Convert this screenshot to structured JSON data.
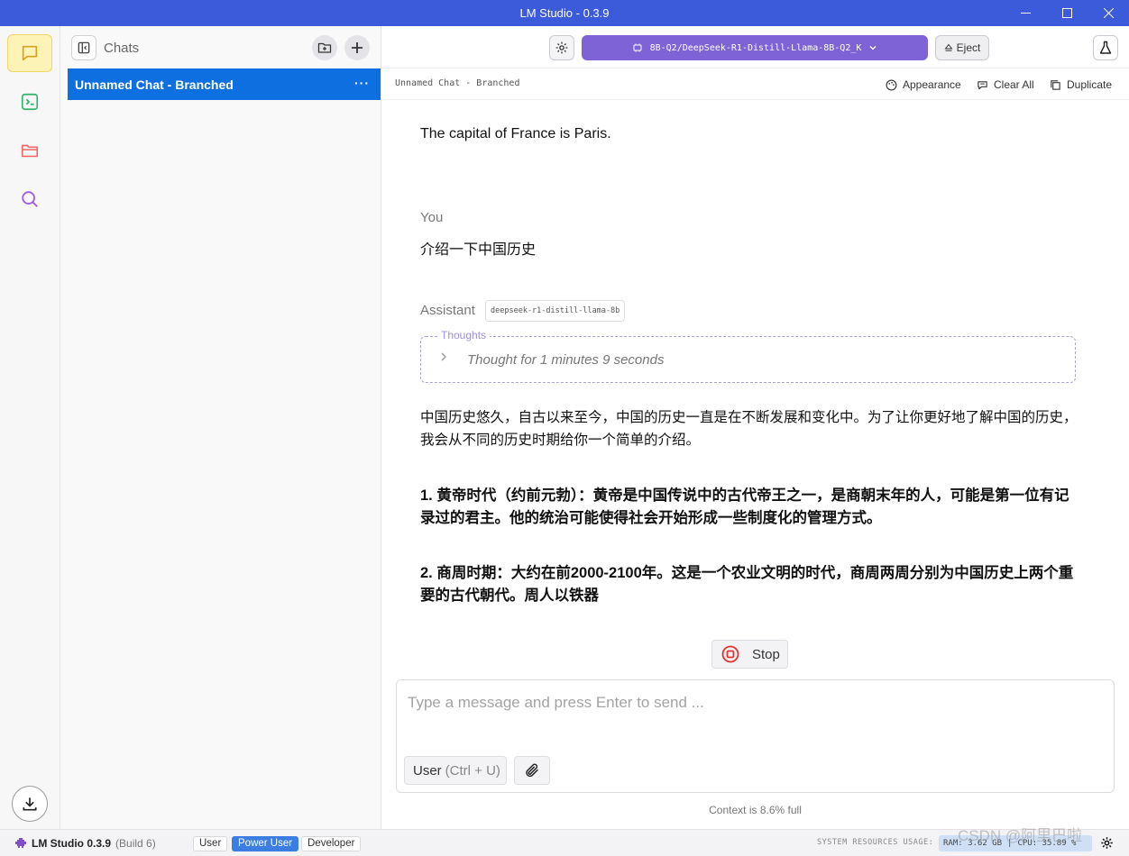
{
  "window": {
    "title": "LM Studio - 0.3.9"
  },
  "sidebar": {
    "title": "Chats",
    "chats": [
      {
        "label": "Unnamed Chat - Branched",
        "more": "···",
        "selected": true
      }
    ]
  },
  "toolbar": {
    "model_label": "8B-Q2/DeepSeek-R1-Distill-Llama-8B-Q2_K",
    "eject_label": "Eject"
  },
  "subbar": {
    "chat_name": "Unnamed Chat - Branched",
    "appearance_label": "Appearance",
    "clear_label": "Clear All",
    "duplicate_label": "Duplicate"
  },
  "conversation": {
    "prev_assistant_text": "The capital of France is Paris.",
    "user_role": "You",
    "user_text": "介绍一下中国历史",
    "assistant_role": "Assistant",
    "assistant_model_tag": "deepseek-r1-distill-llama-8b",
    "thoughts_label": "Thoughts",
    "thoughts_summary": "Thought for 1 minutes 9 seconds",
    "paragraphs": [
      "中国历史悠久，自古以来至今，中国的历史一直是在不断发展和变化中。为了让你更好地了解中国的历史，我会从不同的历史时期给你一个简单的介绍。",
      "1. 黄帝时代（约前元勃）：黄帝是中国传说中的古代帝王之一，是商朝末年的人，可能是第一位有记录过的君主。他的统治可能使得社会开始形成一些制度化的管理方式。",
      "2. 商周时期：大约在前2000-2100年。这是一个农业文明的时代，商周两周分别为中国历史上两个重要的古代朝代。周人以铁器"
    ]
  },
  "stop_label": "Stop",
  "composer": {
    "placeholder": "Type a message and press Enter to send ...",
    "value": "",
    "role_label": "User",
    "role_hint": "(Ctrl + U)"
  },
  "context_text": "Context is 8.6% full",
  "statusbar": {
    "app_name": "LM Studio 0.3.9",
    "build": "(Build 6)",
    "modes": [
      "User",
      "Power User",
      "Developer"
    ],
    "active_mode": "Power User",
    "resources_label": "SYSTEM RESOURCES USAGE:",
    "ram": "RAM: 3.62 GB",
    "cpu": "CPU: 35.89 %"
  },
  "watermark": "CSDN @阿里巴啦",
  "colors": {
    "titlebar": "#3b5bdb",
    "model_selector": "#7d63d6",
    "selected_chat": "#0e6fe0",
    "active_mode": "#3b7de0",
    "rail_active": "#fdf3b7"
  },
  "icons": {
    "rail": [
      "chat-icon",
      "terminal-icon",
      "folder-icon",
      "search-icon"
    ],
    "bottom": "download-icon"
  }
}
